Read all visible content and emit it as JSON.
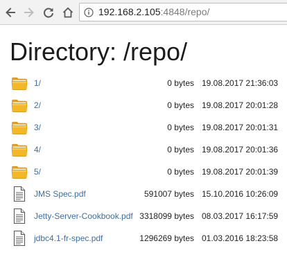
{
  "browser": {
    "url_host": "192.168.2.105",
    "url_rest": ":4848/repo/"
  },
  "page": {
    "title": "Directory: /repo/"
  },
  "listing": [
    {
      "name": "1/",
      "size": "0 bytes",
      "modified": "19.08.2017 21:36:03",
      "type": "folder"
    },
    {
      "name": "2/",
      "size": "0 bytes",
      "modified": "19.08.2017 20:01:28",
      "type": "folder"
    },
    {
      "name": "3/",
      "size": "0 bytes",
      "modified": "19.08.2017 20:01:31",
      "type": "folder"
    },
    {
      "name": "4/",
      "size": "0 bytes",
      "modified": "19.08.2017 20:01:36",
      "type": "folder"
    },
    {
      "name": "5/",
      "size": "0 bytes",
      "modified": "19.08.2017 20:01:39",
      "type": "folder"
    },
    {
      "name": "JMS Spec.pdf",
      "size": "591007 bytes",
      "modified": "15.10.2016 10:26:09",
      "type": "file"
    },
    {
      "name": "Jetty-Server-Cookbook.pdf",
      "size": "3318099 bytes",
      "modified": "08.03.2017 16:17:59",
      "type": "file"
    },
    {
      "name": "jdbc4.1-fr-spec.pdf",
      "size": "1296269 bytes",
      "modified": "01.03.2016 18:23:58",
      "type": "file"
    }
  ],
  "icons": {
    "back": "arrow-left-icon",
    "forward": "arrow-right-icon",
    "reload": "reload-icon",
    "home": "home-icon",
    "info": "info-icon",
    "folder": "folder-icon",
    "file": "document-icon"
  },
  "colors": {
    "link": "#3b6ea5",
    "folder": "#f6b724",
    "toolbar": "#f2f2f2"
  }
}
